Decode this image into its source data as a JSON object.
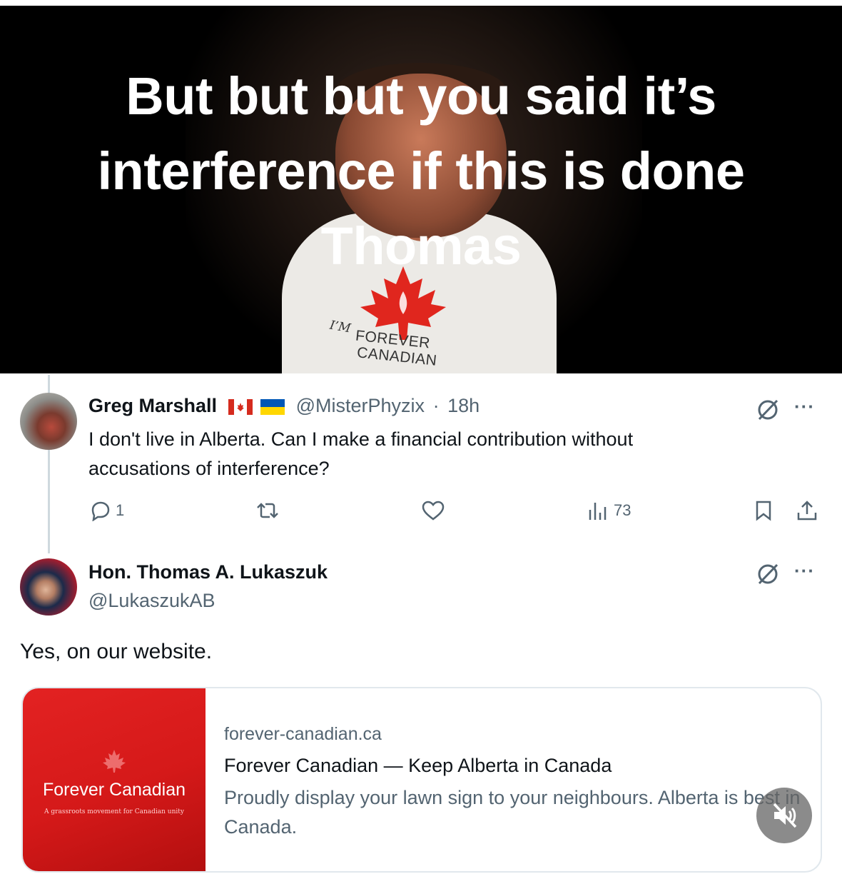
{
  "banner": {
    "caption_lines": [
      "But but but you said it’s",
      "interference if this is done",
      "Thomas"
    ],
    "shirt": {
      "line1": "I’M",
      "line2": "FOREVER",
      "line3": "CANADIAN"
    }
  },
  "reply_tweet": {
    "author": "Greg Marshall",
    "handle": "@MisterPhyzix",
    "separator": "·",
    "time": "18h",
    "text": "I don't live in Alberta. Can I make a financial contribution without accusations of interference?",
    "stats": {
      "replies": "1",
      "retweets": "",
      "likes": "",
      "views": "73"
    },
    "icons": [
      "canada-flag-icon",
      "ukraine-flag-icon",
      "grok-icon",
      "more-icon",
      "reply-icon",
      "retweet-icon",
      "like-icon",
      "views-icon",
      "bookmark-icon",
      "share-icon"
    ]
  },
  "main_tweet": {
    "author": "Hon. Thomas A. Lukaszuk",
    "handle": "@LukaszukAB",
    "text": "Yes, on our website."
  },
  "link_card": {
    "image_brand": "Forever Canadian",
    "image_tagline": "A grassroots movement for Canadian unity",
    "domain": "forever-canadian.ca",
    "title": "Forever Canadian — Keep Alberta in Canada",
    "description": "Proudly display your lawn sign to your neighbours. Alberta is best in Canada."
  },
  "colors": {
    "canada_red": "#d52b1e",
    "muted_text": "#536471",
    "text": "#0f1419",
    "card_red": "#e32222"
  }
}
